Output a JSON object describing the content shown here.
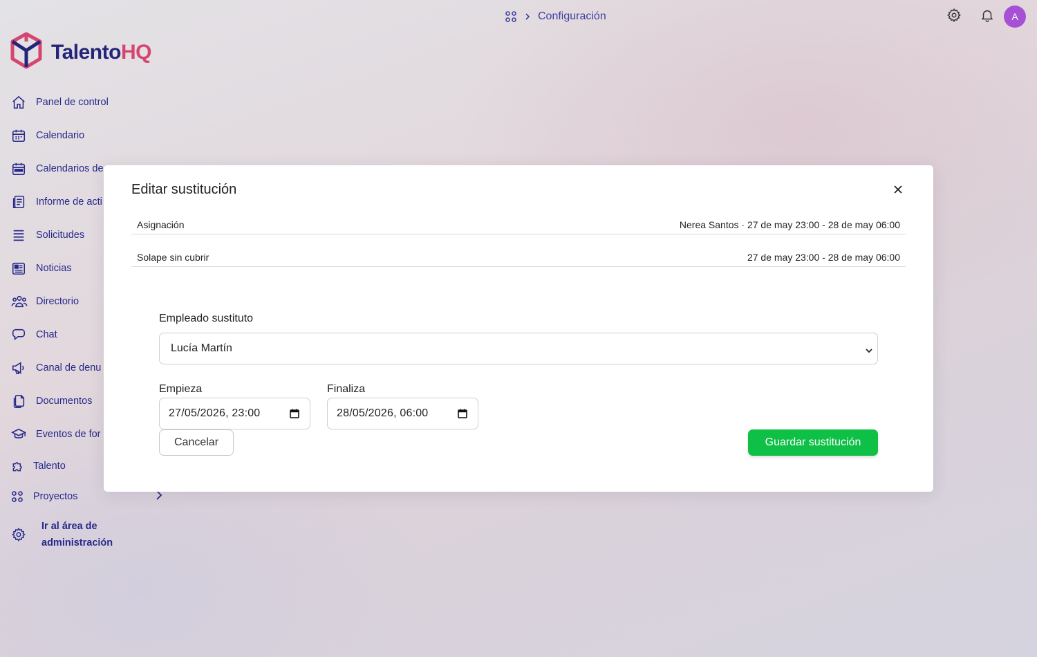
{
  "breadcrumb": {
    "current": "Configuración"
  },
  "brand": {
    "name_part1": "Talento",
    "name_part2": "HQ",
    "primary": "#24247a",
    "accent": "#d5466f"
  },
  "header": {
    "avatar_initial": "A"
  },
  "sidebar": {
    "items": [
      {
        "label": "Panel de control",
        "icon": "home-icon"
      },
      {
        "label": "Calendario",
        "icon": "calendar-icon"
      },
      {
        "label": "Calendarios de",
        "icon": "calendar-list-icon"
      },
      {
        "label": "Informe de acti",
        "icon": "clipboard-icon"
      },
      {
        "label": "Solicitudes",
        "icon": "list-icon"
      },
      {
        "label": "Noticias",
        "icon": "newspaper-icon"
      },
      {
        "label": "Directorio",
        "icon": "users-icon"
      },
      {
        "label": "Chat",
        "icon": "chat-icon"
      },
      {
        "label": "Canal de denu",
        "icon": "megaphone-icon"
      },
      {
        "label": "Documentos",
        "icon": "documents-icon"
      },
      {
        "label": "Eventos de for",
        "icon": "graduation-cap-icon"
      },
      {
        "label": "Talento",
        "icon": "puzzle-icon"
      },
      {
        "label": "Proyectos",
        "icon": "grid-icon"
      }
    ],
    "admin_label": "Ir al área de administración"
  },
  "modal": {
    "title": "Editar sustitución",
    "rows": [
      {
        "label": "Asignación",
        "value": "Nerea Santos · 27 de may 23:00 - 28 de may 06:00"
      },
      {
        "label": "Solape sin cubrir",
        "value": "27 de may 23:00 - 28 de may 06:00"
      }
    ],
    "employee_label": "Empleado sustituto",
    "employee_value": "Lucía Martín",
    "start_label": "Empieza",
    "start_value": "27/05/2026, 23:00",
    "end_label": "Finaliza",
    "end_value": "28/05/2026, 06:00",
    "cancel_label": "Cancelar",
    "save_label": "Guardar sustitución",
    "save_color": "#0ec046"
  }
}
